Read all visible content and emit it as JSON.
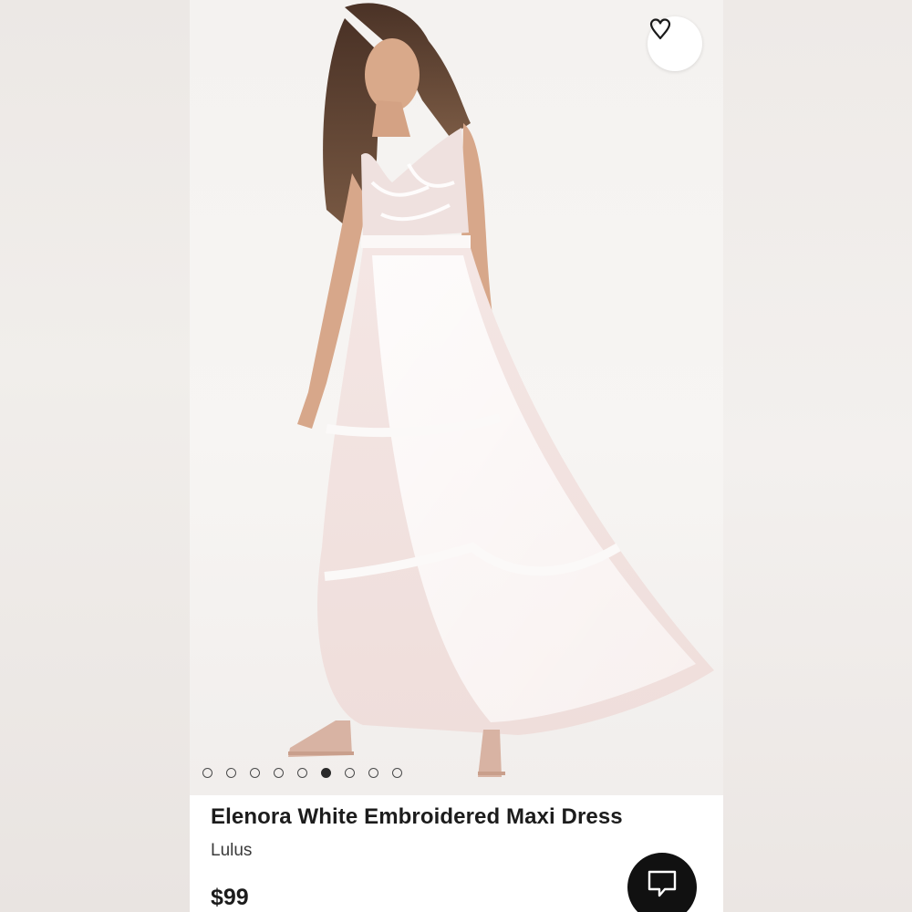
{
  "product": {
    "title": "Elenora White Embroidered Maxi Dress",
    "brand": "Lulus",
    "price": "$99"
  },
  "gallery": {
    "image_count": 9,
    "active_index": 5
  },
  "icons": {
    "favorite": "heart-outline-icon",
    "chat": "chat-bubble-icon"
  },
  "colors": {
    "chat_button": "#111111",
    "text": "#1c1c1c",
    "dot_active": "#2a2a2a"
  }
}
